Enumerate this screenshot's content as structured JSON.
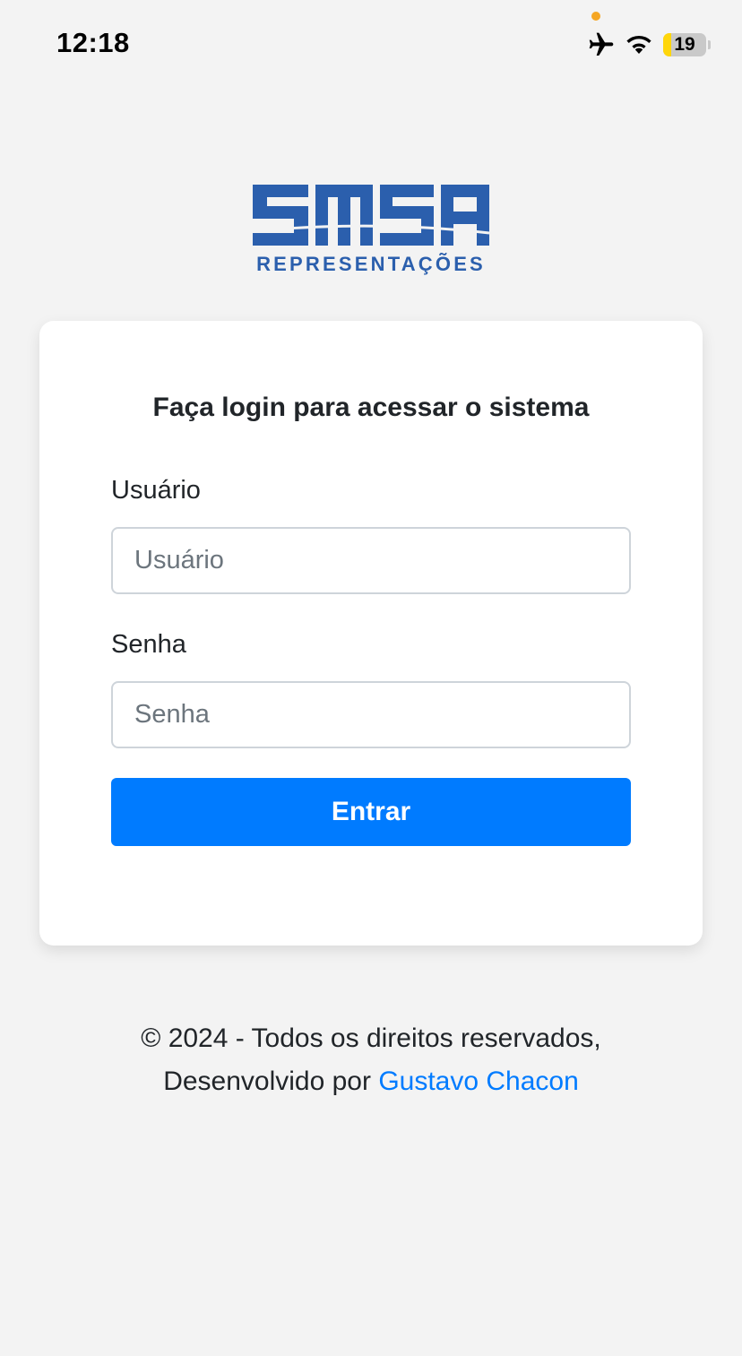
{
  "status_bar": {
    "time": "12:18",
    "battery_level": "19",
    "battery_fraction": 0.19,
    "icons": [
      "airplane-icon",
      "wifi-icon",
      "battery-icon"
    ]
  },
  "logo": {
    "wordmark": "SMSA",
    "tagline": "REPRESENTAÇÕES"
  },
  "login": {
    "title": "Faça login para acessar o sistema",
    "username_label": "Usuário",
    "username_placeholder": "Usuário",
    "username_value": "",
    "password_label": "Senha",
    "password_placeholder": "Senha",
    "password_value": "",
    "submit_label": "Entrar"
  },
  "footer": {
    "copyright": "© 2024 - Todos os direitos reservados,",
    "developed_by": "Desenvolvido por",
    "author_link": "Gustavo Chacon"
  },
  "colors": {
    "background": "#f3f3f3",
    "primary": "#007bff",
    "logo_blue": "#2b5fad",
    "battery_fill": "#ffd60a",
    "privacy_dot": "#f5a623"
  }
}
